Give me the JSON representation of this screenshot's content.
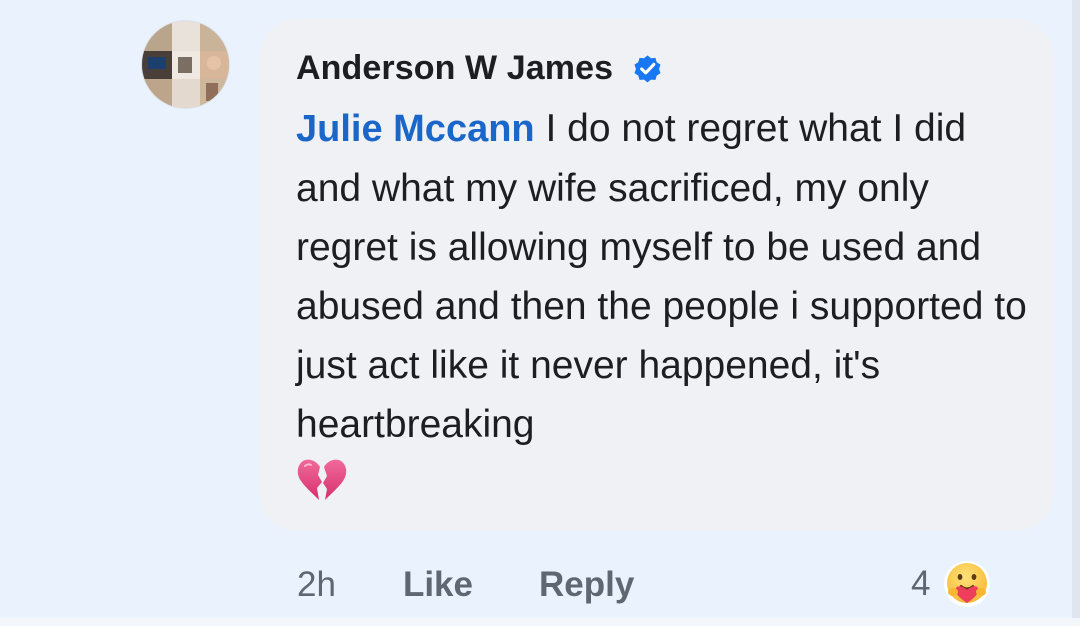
{
  "comment": {
    "author": "Anderson W James",
    "verified_icon": "verified-badge-icon",
    "mention": "Julie Mccann",
    "text": " I do not regret what I did and what my wife sacrificed, my only regret is allowing myself to be used and abused and then the people i supported to just act like it never happened, it's heartbreaking",
    "emoji": "💔"
  },
  "actions": {
    "time": "2h",
    "like_label": "Like",
    "reply_label": "Reply"
  },
  "reactions": {
    "count": "4",
    "icon": "care-reaction-icon"
  },
  "colors": {
    "background": "#e9f2fd",
    "bubble": "#f0f1f5",
    "mention": "#1a67c9",
    "verified": "#1877f2",
    "muted_text": "#5f6772"
  }
}
